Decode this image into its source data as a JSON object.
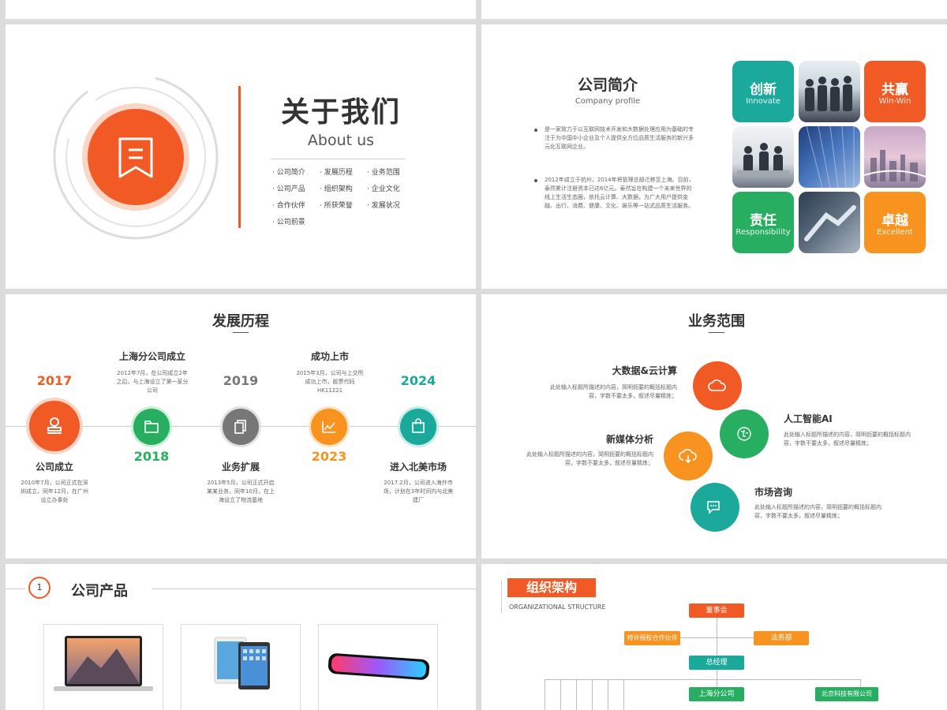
{
  "about": {
    "title": "关于我们",
    "subtitle": "About us",
    "menu": [
      "· 公司简介",
      "· 发展历程",
      "· 业务范围",
      "· 公司产品",
      "· 组织架构",
      "· 企业文化",
      "· 合作伙伴",
      "· 所获荣誉",
      "· 发展状况",
      "· 公司前景"
    ]
  },
  "profile": {
    "title": "公司简介",
    "subtitle": "Company profile",
    "p1": "是一家致力于以互联网技术开发和大数据处理应用为基础的专注于为中国中小企业及个人提供全方位品质生活服务的新兴多元化互联网企业。",
    "p2": "2012年成立于杭州，2014年将管理总部迁移至上海。目前，泰然累计注册资本已达6亿元。泰然旨在构建一个未来世界的线上生活生态圈，依托云计算、大数据，为广大用户提供金融、出行、消费、健康、文化、娱乐等一站式品质生活服务。",
    "tiles": [
      {
        "cn": "创新",
        "en": "Innovate",
        "color": "#1aa99a"
      },
      {
        "cn": "共赢",
        "en": "Win-Win",
        "color": "#f15a24"
      },
      {
        "cn": "责任",
        "en": "Responsibility",
        "color": "#27ae60"
      },
      {
        "cn": "卓越",
        "en": "Excellent",
        "color": "#f7931e"
      }
    ]
  },
  "history": {
    "title": "发展历程",
    "items": [
      {
        "year": "2017",
        "label": "公司成立",
        "desc": "2010年7月，公司正式在深圳成立，同年12月，在广州设立办事处",
        "color": "#f15a24"
      },
      {
        "year": "2018",
        "label": "上海分公司成立",
        "desc": "2012年7月，在公司成立2年之后，与上海设立了第一家分公司",
        "color": "#27ae60"
      },
      {
        "year": "2019",
        "label": "业务扩展",
        "desc": "2013年5月，公司正式开启某某业务，同年10月，在上海设立了物流基地",
        "color": "#777777"
      },
      {
        "year": "2023",
        "label": "成功上市",
        "desc": "2015年3月，公司与上交所成功上市，股票代码HK11221",
        "color": "#f7931e"
      },
      {
        "year": "2024",
        "label": "进入北美市场",
        "desc": "2017.2月，公司进入海外市场，计划在3年时间内与北美建厂",
        "color": "#1aa99a"
      }
    ]
  },
  "business": {
    "title": "业务范围",
    "desc": "此处输入标题所描述的内容，简明扼要的概括标题内容，字数不要太多，叙述尽量精炼；",
    "items": [
      {
        "label": "大数据&云计算",
        "color": "#f15a24",
        "icon": "cloud-icon"
      },
      {
        "label": "人工智能AI",
        "color": "#27ae60",
        "icon": "brain-icon"
      },
      {
        "label": "新媒体分析",
        "color": "#f7931e",
        "icon": "cloud-download-icon"
      },
      {
        "label": "市场咨询",
        "color": "#1aa99a",
        "icon": "chat-icon"
      }
    ]
  },
  "products": {
    "number": "1",
    "title": "公司产品"
  },
  "org": {
    "title": "组织架构",
    "subtitle": "ORGANIZATIONAL STRUCTURE",
    "board": "董事会",
    "partner": "特许授权合作伙伴",
    "legal": "法务部",
    "gm": "总经理",
    "shanghai": "上海分公司",
    "beijing": "北京科技有限公司"
  },
  "colors": {
    "orange": "#f15a24",
    "green": "#27ae60",
    "teal": "#1aa99a",
    "amber": "#f7931e",
    "gray": "#777777"
  }
}
